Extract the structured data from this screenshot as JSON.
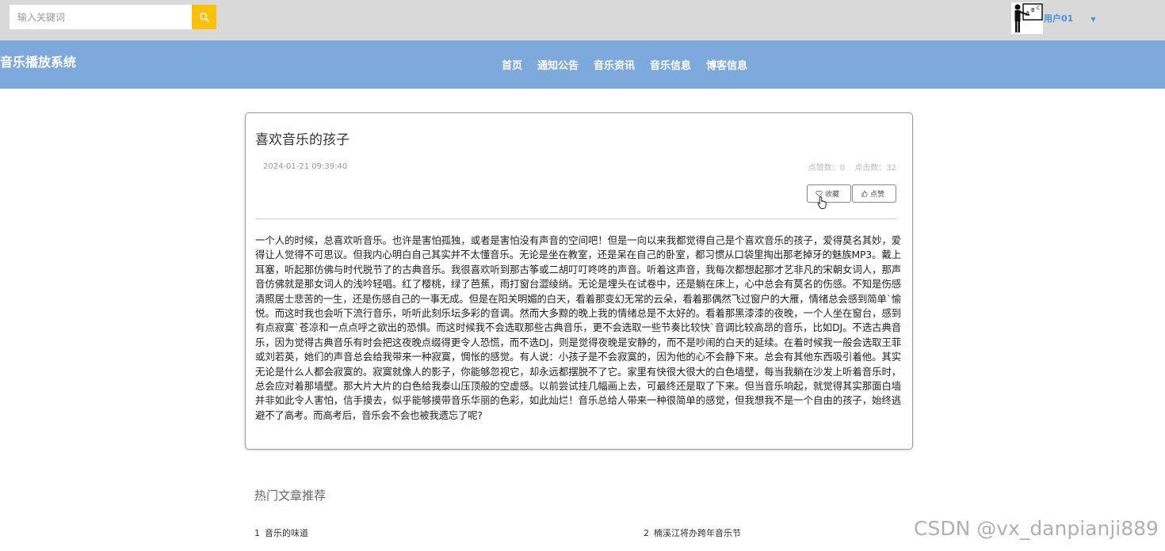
{
  "search": {
    "placeholder": "输入关键词",
    "icon": "search-icon"
  },
  "user": {
    "name": "用户01",
    "avatar_icon": "teacher-board-avatar-icon",
    "caret_icon": "caret-down-icon"
  },
  "brand": "音乐播放系统",
  "nav": [
    {
      "label": "首页"
    },
    {
      "label": "通知公告"
    },
    {
      "label": "音乐资讯"
    },
    {
      "label": "音乐信息"
    },
    {
      "label": "博客信息"
    }
  ],
  "article": {
    "title": "喜欢音乐的孩子",
    "date": "2024-01-21 09:39:40",
    "likes_label": "点赞数：0",
    "clicks_label": "点击数：32",
    "favorite_label": "收藏",
    "like_label": "点赞",
    "body": "一个人的时候，总喜欢听音乐。也许是害怕孤独，或者是害怕没有声音的空间吧！但是一向以来我都觉得自己是个喜欢音乐的孩子，爱得莫名其妙，爱得让人觉得不可思议。但我内心明白自己其实并不太懂音乐。无论是坐在教室，还是呆在自己的卧室，都习惯从口袋里掏出那老掉牙的魅族MP3。戴上耳塞，听起那仿佛与时代脱节了的古典音乐。我很喜欢听到那古筝或二胡叮叮咚咚的声音。听着这声音，我每次都想起那才艺非凡的宋朝女词人，那声音仿佛就是那女词人的浅吟轻唱。红了樱桃，绿了芭蕉，雨打窗台澀绫绡。无论是埋头在试卷中，还是躺在床上，心中总会有莫名的伤感。不知是伤感清照居士悲苦的一生，还是伤感自己的一事无成。但是在阳关明媚的白天，看着那变幻无常的云朵，看着那偶然飞过窗户的大雁，情绪总会感到简单`愉悦。而这时我也会听下流行音乐，听听此刻乐坛多彩的音调。然而大多黥的晚上我的情绪总是不太好的。看着那黑漆漆的夜晚，一个人坐在窗台，感到有点寂寞`苍凉和一点点呼之欲出的恐惧。而这时候我不会选取那些古典音乐，更不会选取一些节奏比较快`音调比较高昂的音乐，比如DJ。不选古典音乐，因为觉得古典音乐有时会把这夜晚点缀得更令人恐慌，而不选DJ，则是觉得夜晚是安静的，而不是吵闹的白天的延续。在着时候我一般会选取王菲或刘若英，她们的声音总会给我带来一种寂寞，惆怅的感觉。有人说：小孩子是不会寂寞的，因为他的心不会静下来。总会有其他东西吸引着他。其实无论是什么人都会寂寞的。寂寞就像人的影子，你能够忽视它，却永远都摆脱不了它。家里有快很大很大的白色墙壁，每当我躺在沙发上听着音乐时，总会应对着那墙壁。那大片大片的白色给我泰山压顶般的空虚感。以前尝试挂几幅画上去，可最终还是取了下来。但当音乐响起，就觉得其实那面白墙并非如此令人害怕，信手摸去，似乎能够摸带音乐华丽的色彩，如此灿烂！音乐总给人带来一种很简单的感觉，但我想我不是一个自由的孩子，始终逃避不了高考。而高考后，音乐会不会也被我遗忘了呢?"
  },
  "hot": {
    "title": "热门文章推荐",
    "items": [
      {
        "num": "1",
        "label": "音乐的味道"
      },
      {
        "num": "2",
        "label": "楠溪江将办跨年音乐节"
      }
    ]
  },
  "watermark": "CSDN @vx_danpianji889",
  "colors": {
    "navbar": "#7ea9dc",
    "search_button": "#ffc107",
    "topbar": "#d9d9d9",
    "user_name": "#4a90e2"
  }
}
